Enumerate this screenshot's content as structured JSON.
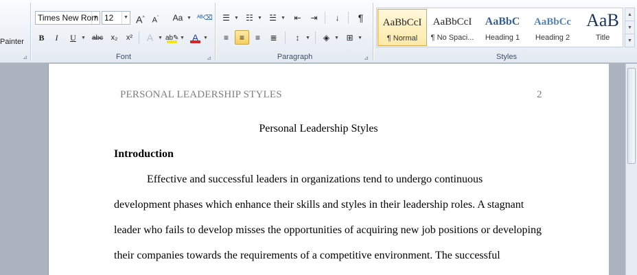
{
  "clipboard": {
    "painter_label": "Painter"
  },
  "font": {
    "group_label": "Font",
    "font_name": "Times New Rom",
    "font_size": "12",
    "buttons": {
      "grow": "A",
      "shrink": "A",
      "change_case": "Aa",
      "bold": "B",
      "italic": "I",
      "underline": "U",
      "strike": "abc",
      "subscript": "x₂",
      "superscript": "x²",
      "font_color": "A"
    },
    "highlight_color": "#f5e31b",
    "font_color_value": "#e02020"
  },
  "paragraph": {
    "group_label": "Paragraph",
    "pilcrow": "¶"
  },
  "styles": {
    "group_label": "Styles",
    "items": [
      {
        "preview": "AaBbCcI",
        "name": "¶ Normal",
        "selected": true
      },
      {
        "preview": "AaBbCcI",
        "name": "¶ No Spaci...",
        "selected": false
      },
      {
        "preview": "AaBbC",
        "name": "Heading 1",
        "selected": false
      },
      {
        "preview": "AaBbCc",
        "name": "Heading 2",
        "selected": false
      },
      {
        "preview": "AaB",
        "name": "Title",
        "selected": false
      }
    ],
    "heading_color": "#365f91"
  },
  "document": {
    "header_text": "PERSONAL LEADERSHIP STYLES",
    "page_number": "2",
    "title": "Personal Leadership Styles",
    "section_heading": "Introduction",
    "lines": [
      "Effective and successful leaders in organizations  tend to undergo continuous",
      "development phases which enhance their skills  and styles in their leadership roles.  A stagnant",
      "leader who fails to develop misses  the opportunities of acquiring  new job positions or developing",
      "their companies  towards the requirements  of a competitive  environment.  The successful"
    ]
  }
}
